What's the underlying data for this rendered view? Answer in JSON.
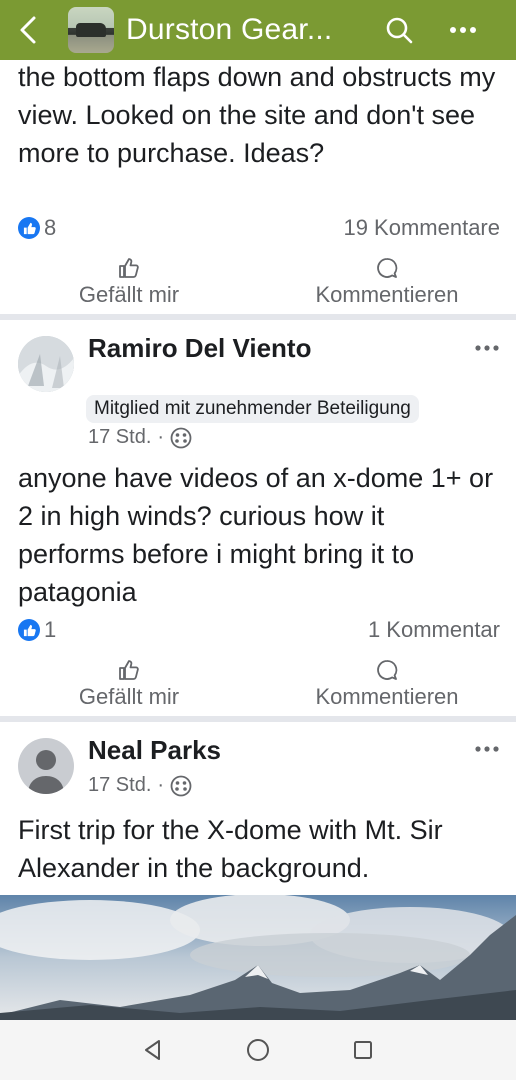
{
  "header": {
    "title": "Durston Gear...",
    "color": "#7b9a33"
  },
  "post1": {
    "text": "the bottom flaps down and obstructs my view.  Looked on the site and don't see more to purchase. Ideas?",
    "likes": "8",
    "comments": "19 Kommentare",
    "like_label": "Gefällt mir",
    "comment_label": "Kommentieren"
  },
  "post2": {
    "author": "Ramiro Del Viento",
    "badge": "Mitglied mit zunehmender Beteiligung",
    "time": "17 Std.",
    "dot": "·",
    "text": "anyone have videos of an x-dome 1+ or 2 in high winds? curious how it performs before i might bring it to patagonia",
    "likes": "1",
    "comments": "1 Kommentar",
    "like_label": "Gefällt mir",
    "comment_label": "Kommentieren"
  },
  "post3": {
    "author": "Neal Parks",
    "time": "17 Std.",
    "dot": "·",
    "text": "First trip for the X-dome with Mt. Sir Alexander in the background."
  }
}
